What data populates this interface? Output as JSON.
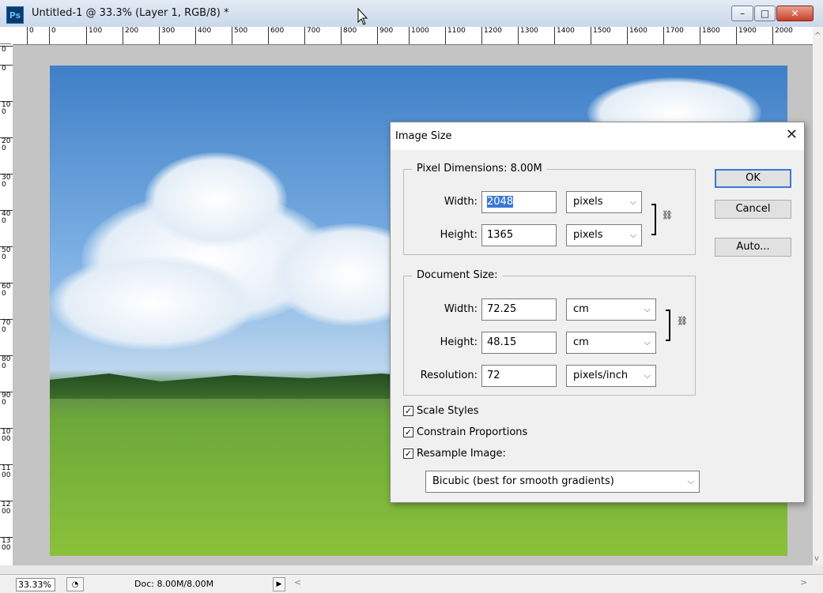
{
  "window": {
    "app_icon": "Ps",
    "title": "Untitled-1 @ 33.3% (Layer 1, RGB/8) *",
    "controls": {
      "minimize": "–",
      "maximize": "□",
      "close": "✕"
    }
  },
  "ruler_h": [
    "0",
    "0",
    "100",
    "200",
    "300",
    "400",
    "500",
    "600",
    "700",
    "800",
    "900",
    "1000",
    "1100",
    "1200",
    "1300",
    "1400",
    "1500",
    "1600",
    "1700",
    "1800",
    "1900",
    "2000"
  ],
  "ruler_v": [
    "0",
    "0",
    "100",
    "200",
    "300",
    "400",
    "500",
    "600",
    "700",
    "800",
    "900",
    "1000",
    "1100",
    "1200",
    "1300"
  ],
  "status": {
    "zoom": "33.33%",
    "doc": "Doc: 8.00M/8.00M",
    "arrow": "▶",
    "scroll_left": "<",
    "scroll_right": ">"
  },
  "dialog": {
    "title": "Image Size",
    "close": "✕",
    "pixel_dimensions": {
      "legend": "Pixel Dimensions:  8.00M",
      "width_label": "Width:",
      "width_value": "2048",
      "width_unit": "pixels",
      "height_label": "Height:",
      "height_value": "1365",
      "height_unit": "pixels"
    },
    "document_size": {
      "legend": "Document Size:",
      "width_label": "Width:",
      "width_value": "72.25",
      "width_unit": "cm",
      "height_label": "Height:",
      "height_value": "48.15",
      "height_unit": "cm",
      "resolution_label": "Resolution:",
      "resolution_value": "72",
      "resolution_unit": "pixels/inch"
    },
    "buttons": {
      "ok": "OK",
      "cancel": "Cancel",
      "auto": "Auto..."
    },
    "checkboxes": {
      "scale_styles": "Scale Styles",
      "constrain": "Constrain Proportions",
      "resample": "Resample Image:"
    },
    "resample_method": "Bicubic (best for smooth gradients)",
    "chevron": "⌵",
    "checkmark": "✓"
  }
}
